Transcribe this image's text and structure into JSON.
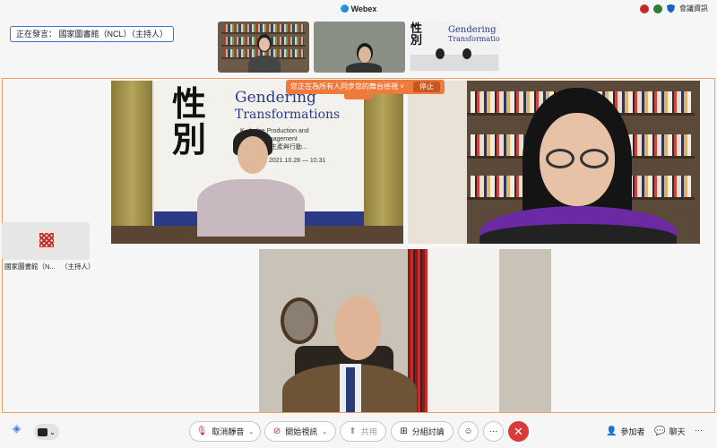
{
  "window": {
    "app_title": "Webex"
  },
  "top_right": {
    "meeting_info_label": "會議資訊"
  },
  "speaking": {
    "label": "正在發言：",
    "name": "國家圖書館（NCL）（主持人）"
  },
  "share_banner": {
    "message": "您正在為所有人同步您的舞台檢視 ˅",
    "stop_label": "停止"
  },
  "host": {
    "name": "國家圖書館（N...",
    "role": "（主持人）"
  },
  "poster": {
    "chinese_title": "性別",
    "english_title_line1": "Gendering",
    "english_title_line2": "Transformations",
    "subtitle_line1": "K...ledge Production and",
    "subtitle_line2": "Activist Engagement",
    "subtitle_cn": "...主義知識生產與行動...",
    "dates": "2021.10.28 — 10.31"
  },
  "thumb_poster": {
    "chinese_title": "性別",
    "english_title_line1": "Gendering",
    "english_title_line2": "Transformations"
  },
  "toolbar": {
    "mute_label": "取消靜音",
    "video_label": "開始視訊",
    "share_label": "共用",
    "breakout_label": "分組討論",
    "more_label": "···",
    "end_label": "✕",
    "participants_label": "參加者",
    "chat_label": "聊天",
    "overflow_label": "···"
  },
  "colors": {
    "accent": "#ef7a3c",
    "end_call": "#d93a3a",
    "speaker_border": "#2f7bd8"
  },
  "icons": [
    "webex-logo-icon",
    "record-icon",
    "status-icon",
    "shield-icon",
    "mic-off-icon",
    "video-off-icon",
    "share-icon",
    "breakout-icon",
    "reaction-icon",
    "more-icon",
    "end-call-icon",
    "participants-icon",
    "chat-icon"
  ]
}
